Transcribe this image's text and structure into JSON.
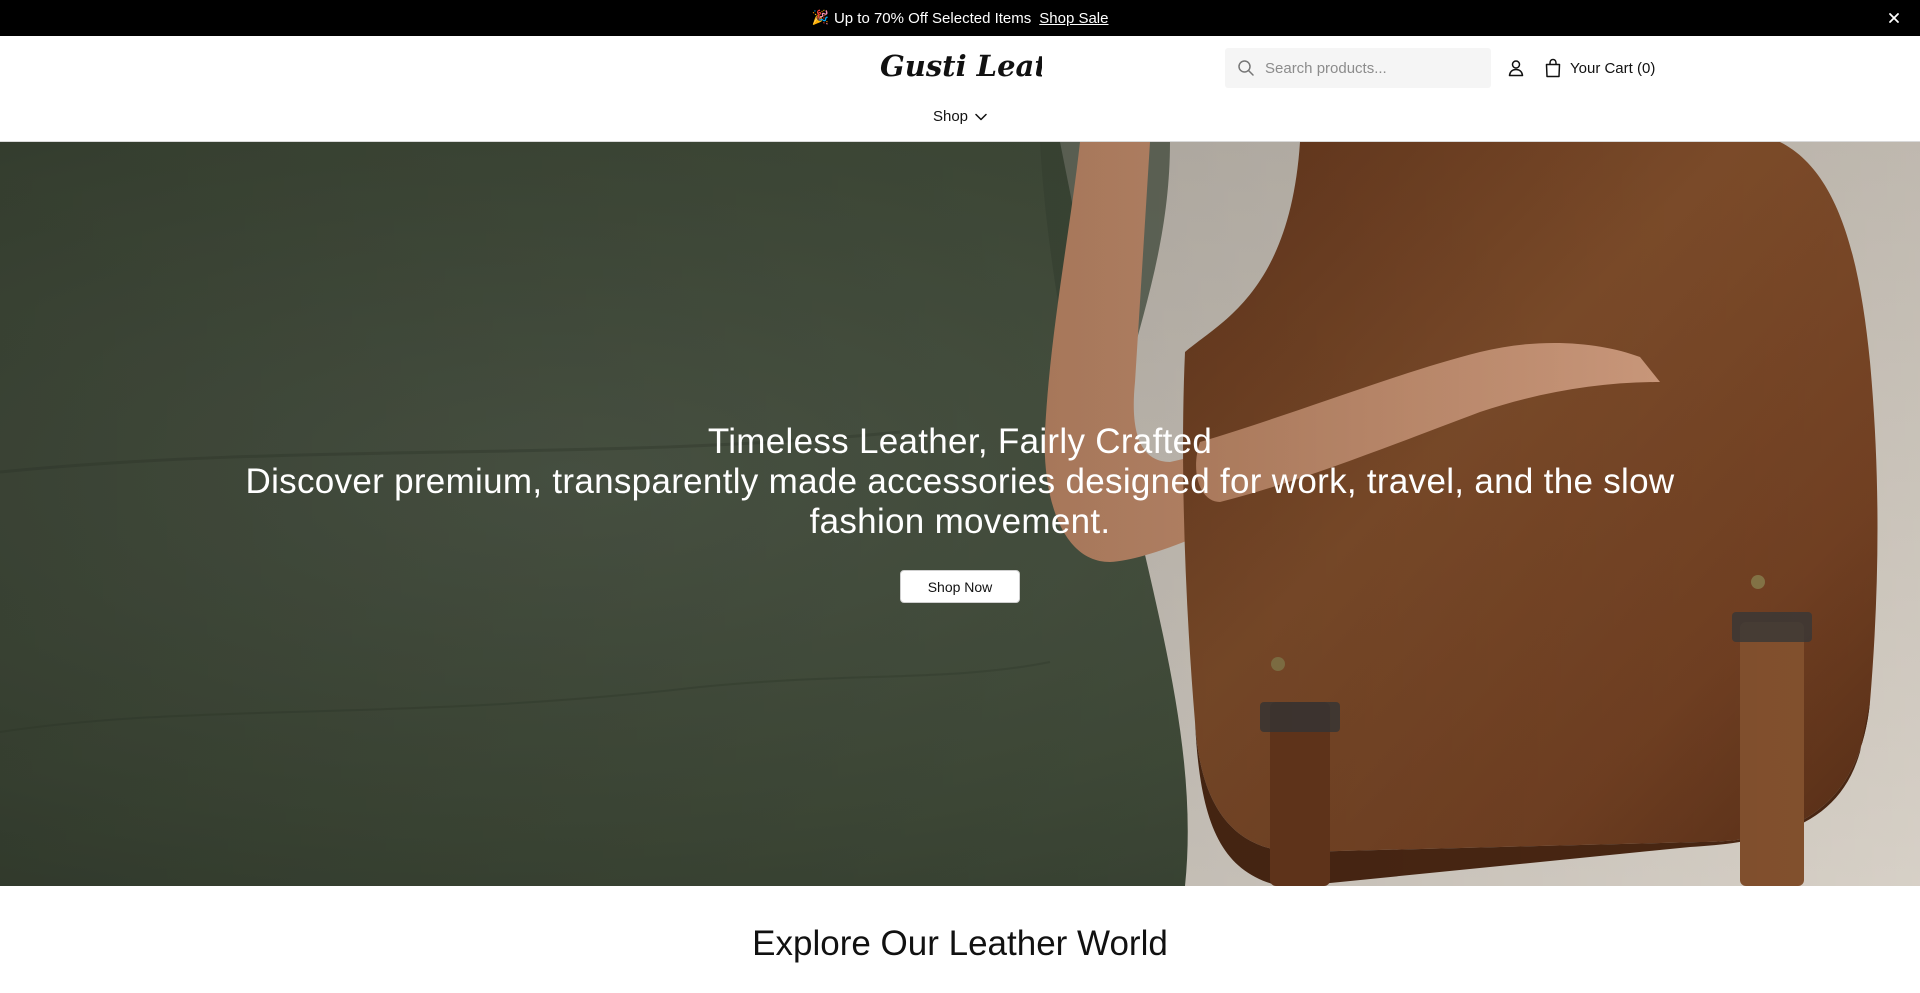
{
  "announcement": {
    "emoji": "🎉",
    "text": "Up to 70% Off Selected Items",
    "link": "Shop Sale",
    "close_icon": "close-icon"
  },
  "header": {
    "logo_text": "Gusti Leather",
    "search": {
      "placeholder": "Search products...",
      "value": "",
      "icon": "search-icon"
    },
    "account_icon": "user-icon",
    "cart": {
      "label": "Your Cart (0)",
      "icon": "shopping-bag-icon"
    },
    "nav": [
      {
        "label": "Shop",
        "icon": "chevron-down-icon"
      }
    ]
  },
  "hero": {
    "title": "Timeless Leather, Fairly Crafted",
    "subtitle": "Discover premium, transparently made accessories designed for work, travel, and the slow fashion movement.",
    "cta": "Shop Now",
    "image": "woman-holding-brown-leather-messenger-bag"
  },
  "section": {
    "title": "Explore Our Leather World"
  },
  "colors": {
    "announcement_bg": "#000000",
    "hero_wall": "#4a5646",
    "bag_leather": "#7a4424",
    "dress": "#ddd6cc",
    "text_dark": "#111111"
  }
}
